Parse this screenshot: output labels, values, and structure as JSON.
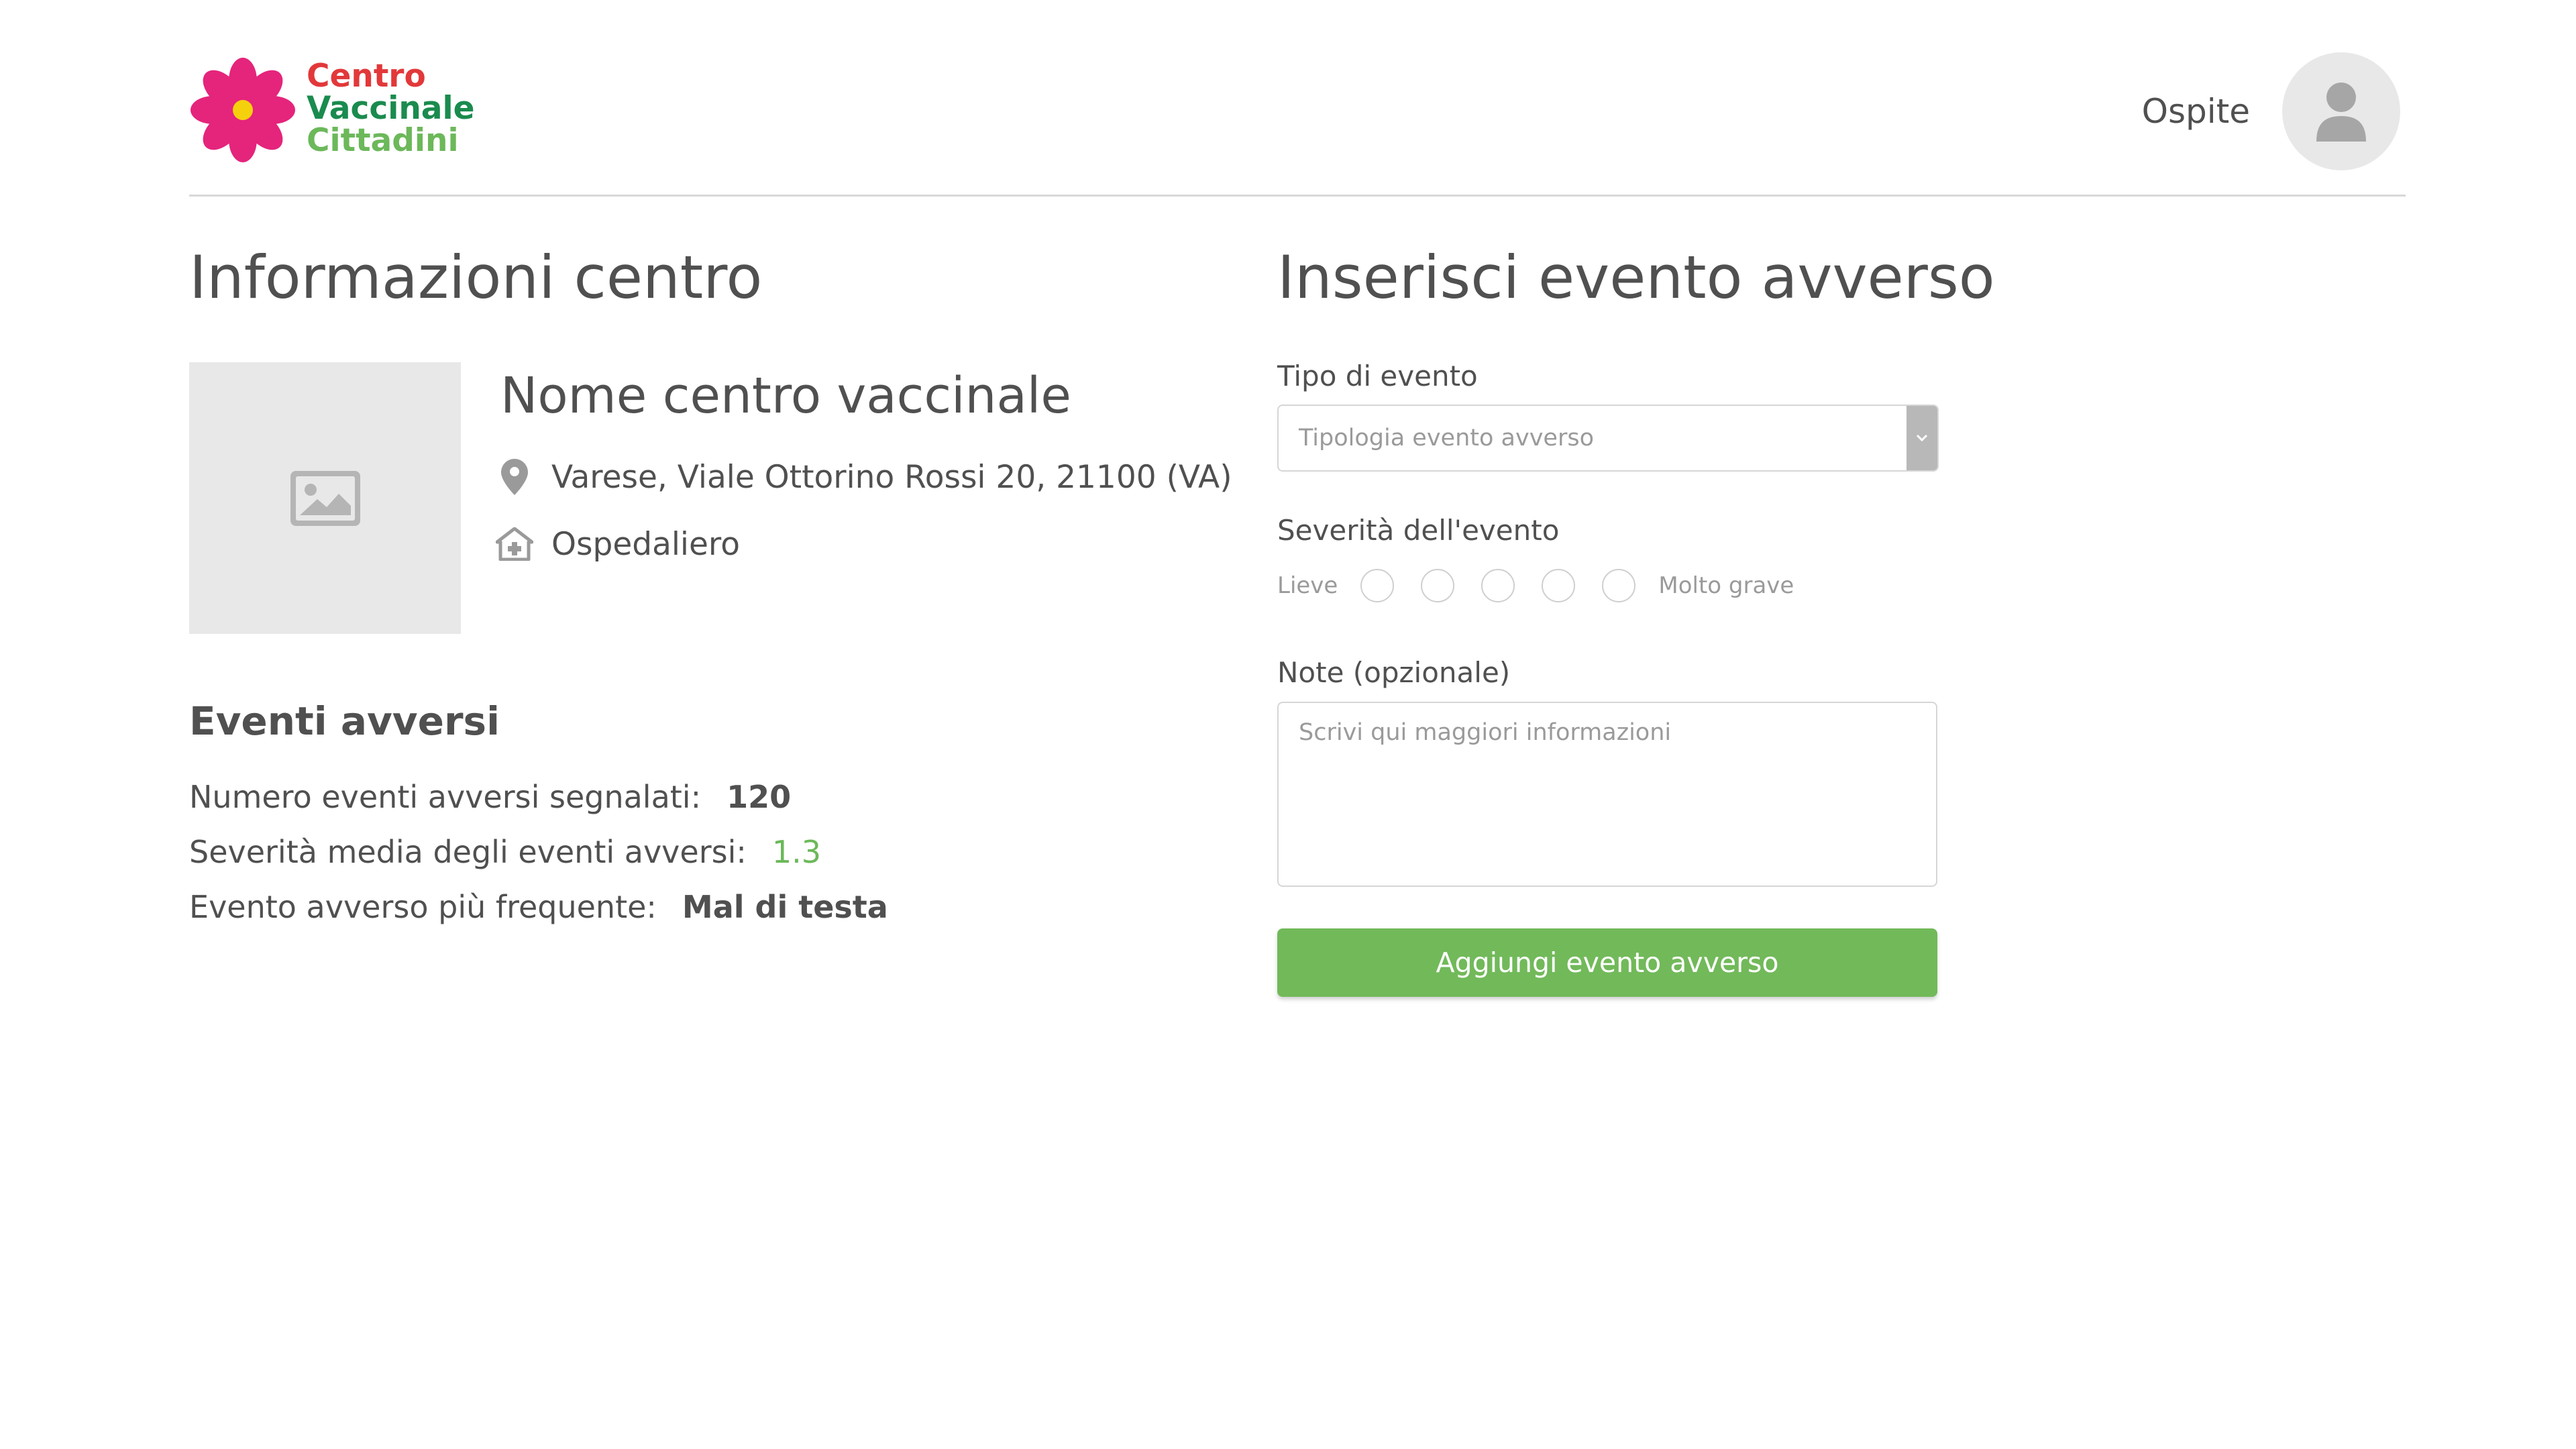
{
  "header": {
    "logo": {
      "line1": "Centro",
      "line2": "Vaccinale",
      "line3": "Cittadini"
    },
    "user_name": "Ospite"
  },
  "colors": {
    "logo_line1": "#e2383a",
    "logo_line2": "#1a8b4e",
    "logo_line3": "#6cb85a",
    "flower_petals": "#e5247c",
    "flower_center": "#f5d10d",
    "accent_green": "#72b95a"
  },
  "center_info": {
    "title": "Informazioni centro",
    "name": "Nome centro vaccinale",
    "address": "Varese, Viale Ottorino Rossi 20, 21100 (VA)",
    "type": "Ospedaliero"
  },
  "adverse_events": {
    "title": "Eventi avversi",
    "stats": [
      {
        "label": "Numero eventi avversi segnalati:",
        "value": "120"
      },
      {
        "label": "Severità media degli eventi avversi:",
        "value": "1.3"
      },
      {
        "label": "Evento avverso più frequente:",
        "value": "Mal di testa"
      }
    ]
  },
  "form": {
    "title": "Inserisci evento avverso",
    "event_type_label": "Tipo di evento",
    "event_type_placeholder": "Tipologia evento avverso",
    "severity_label": "Severità dell'evento",
    "severity_min": "Lieve",
    "severity_max": "Molto grave",
    "notes_label": "Note (opzionale)",
    "notes_placeholder": "Scrivi qui maggiori informazioni",
    "submit_label": "Aggiungi evento avverso"
  },
  "icons": {
    "logo": "flower-logo-icon",
    "avatar": "user-icon",
    "image_placeholder": "image-icon",
    "address": "map-pin-icon",
    "type": "hospital-icon",
    "select": "chevron-down-icon"
  }
}
